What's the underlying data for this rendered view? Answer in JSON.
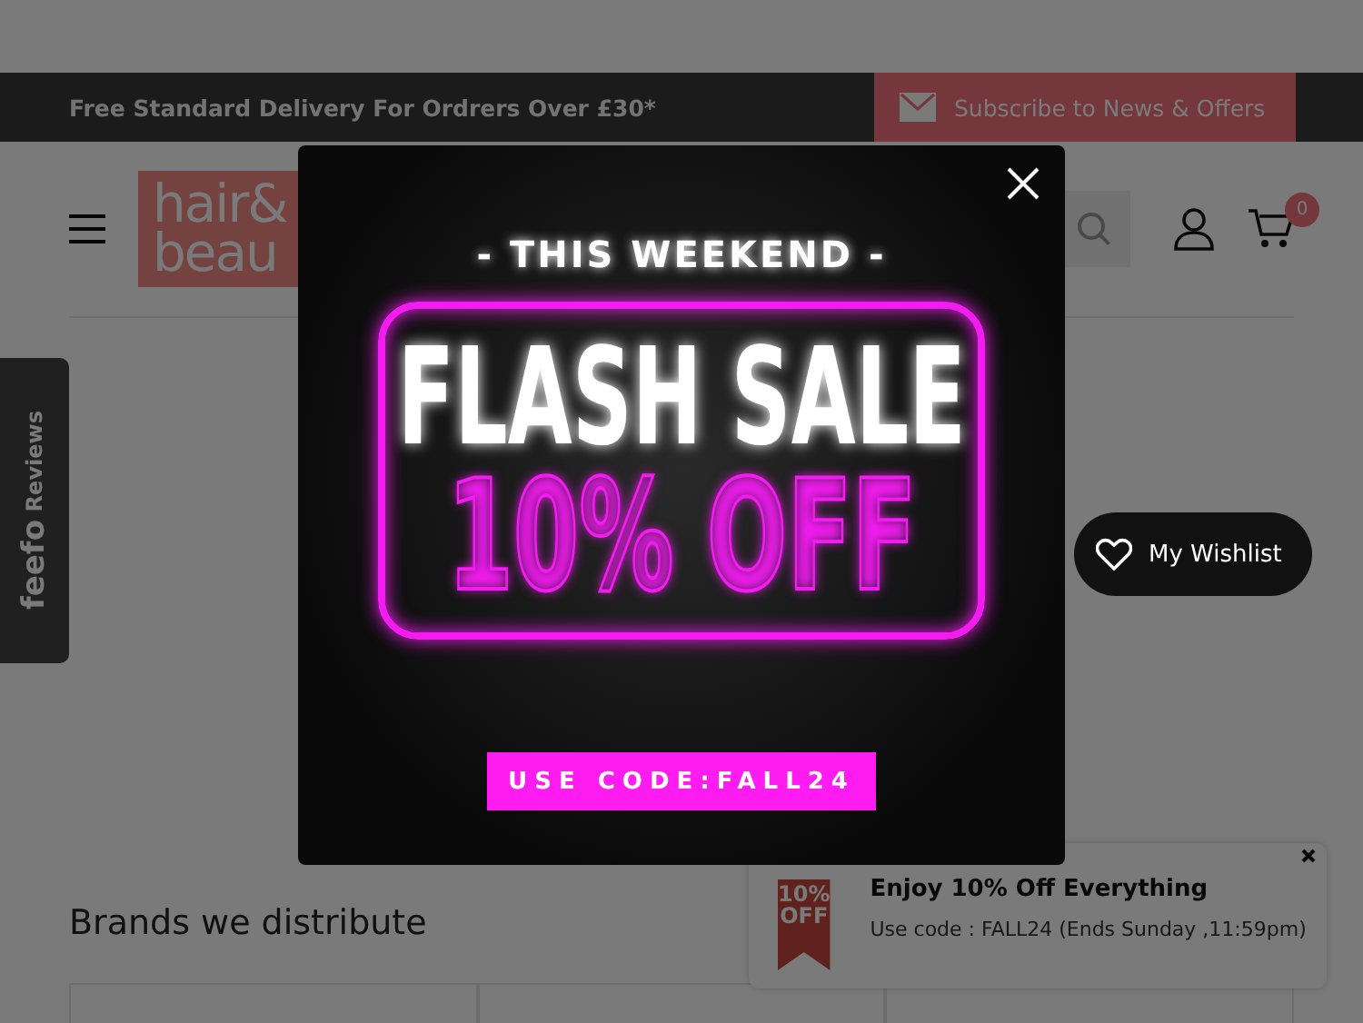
{
  "top_bar": {
    "message": "Free Standard Delivery For Ordrers Over £30*",
    "subscribe_button": "Subscribe to News & Offers"
  },
  "header": {
    "logo_lines": [
      "hair&",
      "beau"
    ],
    "cart_count": "0"
  },
  "feefo_tab": {
    "brand": "feefo",
    "label": "Reviews"
  },
  "brands_section": {
    "title": "Brands we distribute"
  },
  "wishlist_button": "My Wishlist",
  "toast": {
    "badge_lines": [
      "10%",
      "OFF"
    ],
    "title": "Enjoy 10% Off Everything",
    "text": "Use code : FALL24 (Ends Sunday ,11:59pm)"
  },
  "popup": {
    "kicker": "- THIS WEEKEND -",
    "headline": "FLASH SALE",
    "offer": "10% OFF",
    "code_button": "USE CODE:FALL24"
  }
}
